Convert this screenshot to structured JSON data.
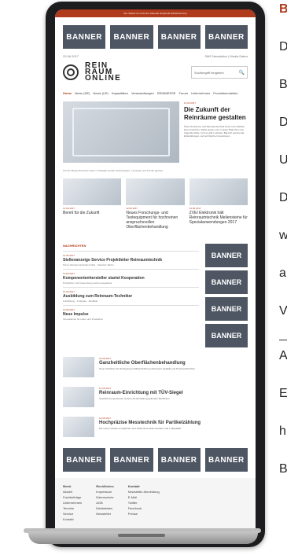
{
  "top_notice": "Der Status ist nicht der Aktuelle Zeitpunkt (Mobilversion)",
  "banners_top": [
    "BANNER",
    "BANNER",
    "BANNER",
    "BANNER"
  ],
  "meta": {
    "left": "20.06.2017",
    "right": "SMS Newsletter | Media Daten"
  },
  "logo_lines": [
    "REIN",
    "RAUM",
    "ONLINE"
  ],
  "search": {
    "placeholder": "Suchbegriff eingeben",
    "icon": "search-icon"
  },
  "nav": [
    {
      "label": "Home",
      "active": true
    },
    {
      "label": "News (DE)",
      "active": false
    },
    {
      "label": "News (US)",
      "active": false
    },
    {
      "label": "Kapazitäten",
      "active": false
    },
    {
      "label": "Veranstaltungen",
      "active": false
    },
    {
      "label": "REINMESSE",
      "active": false
    },
    {
      "label": "Forum",
      "active": false
    },
    {
      "label": "Unternehmen",
      "active": false
    },
    {
      "label": "Produktneuheiten",
      "active": false
    }
  ],
  "hero": {
    "date": "12.06.2017",
    "title": "Die Zukunft der Reinräume gestalten",
    "desc": "Über Reinräume und Reinraumtechnik wird in den Medien kaum berichtet. Dabei spielen sie in vielen Branchen eine tragende Rolle. Und es gibt in diesem Bereich spannende Entwicklungen und technische Innovationen.",
    "caption": "Auf der Messe Reinraum Expo in Stuttgart werden Technologien, Lösungen und Trends gezeigt."
  },
  "cards": [
    {
      "date": "12.06.2017",
      "title": "Bereit für die Zukunft"
    },
    {
      "date": "12.06.2017",
      "title": "Neues Forschungs- und Testequipment für hochreinen anspruchsvollen Oberflächenbehandlung"
    },
    {
      "date": "12.06.2017",
      "title": "ZVEI Elektronik hält Reinraumtechnik Meilensteine für Spezialanwendungen 2017"
    }
  ],
  "news_header": "NACHRICHTEN",
  "news_items": [
    {
      "date": "12.06.2017",
      "title": "Stellenanzeige Service Projektleiter Reinraumtechnik",
      "sub": "Firma: Reinraumtechnik GmbH · Standort: Berlin"
    },
    {
      "date": "12.06.2017",
      "title": "Komponentenhersteller startet Kooperation",
      "sub": "Produktion und Anwendung werden ausgebaut"
    },
    {
      "date": "12.06.2017",
      "title": "Ausbildung zum Reinraum-Techniker",
      "sub": "Fortbildung · 3 Module · Zertifikat"
    },
    {
      "date": "12.06.2017",
      "title": "Neue Impulse",
      "sub": "Innovationen für Labor und Produktion"
    }
  ],
  "side_banners": [
    "BANNER",
    "BANNER",
    "BANNER",
    "BANNER"
  ],
  "features": [
    {
      "date": "12.06.2017",
      "title": "Ganzheitliche Oberflächenbehandlung",
      "desc": "Neue Verfahren für Reinigung und Beschichtung verbessern Qualität und Prozesssicherheit."
    },
    {
      "date": "12.06.2017",
      "title": "Reinraum-Einrichtung mit TÜV-Siegel",
      "desc": "Geprüfte Komponenten sichern die Einhaltung geltender Richtlinien."
    },
    {
      "date": "12.06.2017",
      "title": "Hochpräzise Messtechnik für Partikelzählung",
      "desc": "Die neuen Geräte ermöglichen eine lückenlose Dokumentation der Luftqualität."
    }
  ],
  "banners_bottom": [
    "BANNER",
    "BANNER",
    "BANNER",
    "BANNER"
  ],
  "footer_cols": [
    {
      "title": "Menü",
      "items": [
        "Aktuell",
        "Fachbeiträge",
        "Unternehmen",
        "Termine",
        "Service",
        "Kontakt"
      ]
    },
    {
      "title": "Rechtliches",
      "items": [
        "Impressum",
        "Datenschutz",
        "AGB",
        "Mediadaten",
        "Newsletter"
      ]
    },
    {
      "title": "Kontakt",
      "items": [
        "Newsletter Anmeldung",
        "E-Mail",
        "Twitter",
        "Facebook",
        "Presse"
      ]
    }
  ],
  "right_text": {
    "first": "B",
    "lines": [
      "D",
      "B",
      "D",
      "U",
      "D",
      "w",
      "a",
      "V",
      "A",
      "E",
      "h",
      "B"
    ]
  },
  "colors": {
    "accent": "#b03a1c",
    "banner": "#4e5663"
  }
}
